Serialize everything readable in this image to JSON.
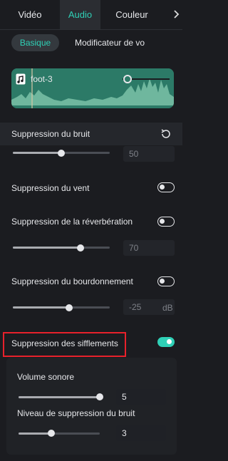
{
  "tabs": [
    {
      "label": "Vidéo",
      "active": false
    },
    {
      "label": "Audio",
      "active": true
    },
    {
      "label": "Couleur",
      "active": false
    }
  ],
  "subtabs": [
    {
      "label": "Basique",
      "active": true
    },
    {
      "label": "Modificateur de vo",
      "active": false
    }
  ],
  "clip": {
    "name": "foot-3",
    "volume_level": 0.1
  },
  "noise_section": {
    "title": "Suppression du bruit",
    "reset_icon": "reset-icon"
  },
  "rows": {
    "noise": {
      "value": "50",
      "level": 0.5
    },
    "wind": {
      "label": "Suppression du vent",
      "enabled": false
    },
    "reverb": {
      "label": "Suppression de la réverbération",
      "enabled": false,
      "value": "70",
      "level": 0.7
    },
    "hum": {
      "label": "Suppression du bourdonnement",
      "enabled": false,
      "value": "-25",
      "unit": "dB",
      "level": 0.58
    },
    "hiss": {
      "label": "Suppression des sifflements",
      "enabled": true
    }
  },
  "hiss_panel": {
    "volume_label": "Volume sonore",
    "volume_value": "5",
    "volume_level": 1.0,
    "reduction_label": "Niveau de suppression du bruit",
    "reduction_value": "3",
    "reduction_level": 0.4
  },
  "colors": {
    "accent": "#2fd0b6",
    "highlight": "#e8212b",
    "waveform": "#2c7a67"
  }
}
